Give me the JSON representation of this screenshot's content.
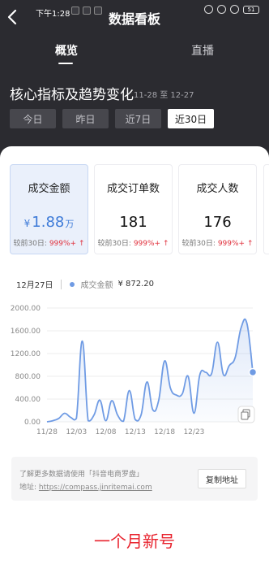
{
  "status_bar": {
    "time": "下午1:28",
    "battery": "51"
  },
  "header": {
    "title": "数据看板"
  },
  "tabs": [
    {
      "label": "概览"
    },
    {
      "label": "直播"
    }
  ],
  "section": {
    "title": "核心指标及趋势变化",
    "date_range": "11-28 至 12-27"
  },
  "range_buttons": [
    {
      "label": "今日"
    },
    {
      "label": "昨日"
    },
    {
      "label": "近7日"
    },
    {
      "label": "近30日"
    }
  ],
  "kpis": [
    {
      "label": "成交金额",
      "currency": "¥",
      "value": "1.88",
      "unit": "万",
      "compare_label": "较前30日:",
      "compare_value": "999%+",
      "arrow": "↑"
    },
    {
      "label": "成交订单数",
      "currency": "",
      "value": "181",
      "unit": "",
      "compare_label": "较前30日:",
      "compare_value": "999%+",
      "arrow": "↑"
    },
    {
      "label": "成交人数",
      "currency": "",
      "value": "176",
      "unit": "",
      "compare_label": "较前30日:",
      "compare_value": "999%+",
      "arrow": "↑"
    }
  ],
  "chart_header": {
    "date": "12月27日",
    "series_name": "成交金额",
    "value": "¥ 872.20"
  },
  "note": {
    "line1": "了解更多数据请使用「抖音电商罗盘」",
    "prefix": "地址:",
    "url": "https://compass.jinritemai.com",
    "copy_label": "复制地址"
  },
  "caption": "一个月新号",
  "colors": {
    "accent": "#3e7bd8",
    "line": "#6f9be4",
    "up": "#e0323e",
    "caption": "#e8232e"
  },
  "chart_data": {
    "type": "line",
    "y_ticks": [
      "2000.00",
      "1600.00",
      "1200.00",
      "800.00",
      "400.00",
      "0.00"
    ],
    "x_ticks": [
      "11/28",
      "12/03",
      "12/08",
      "12/13",
      "12/18",
      "12/23"
    ],
    "ylim": [
      0,
      2000
    ],
    "series": [
      {
        "values": [
          0,
          20,
          60,
          150,
          80,
          60,
          1420,
          20,
          120,
          380,
          20,
          370,
          120,
          10,
          550,
          40,
          120,
          700,
          210,
          380,
          1070,
          590,
          470,
          490,
          800,
          150,
          830,
          870,
          850,
          1400,
          830,
          990,
          1130,
          1650,
          1730,
          872.2
        ]
      }
    ],
    "highlight_index": 35
  }
}
